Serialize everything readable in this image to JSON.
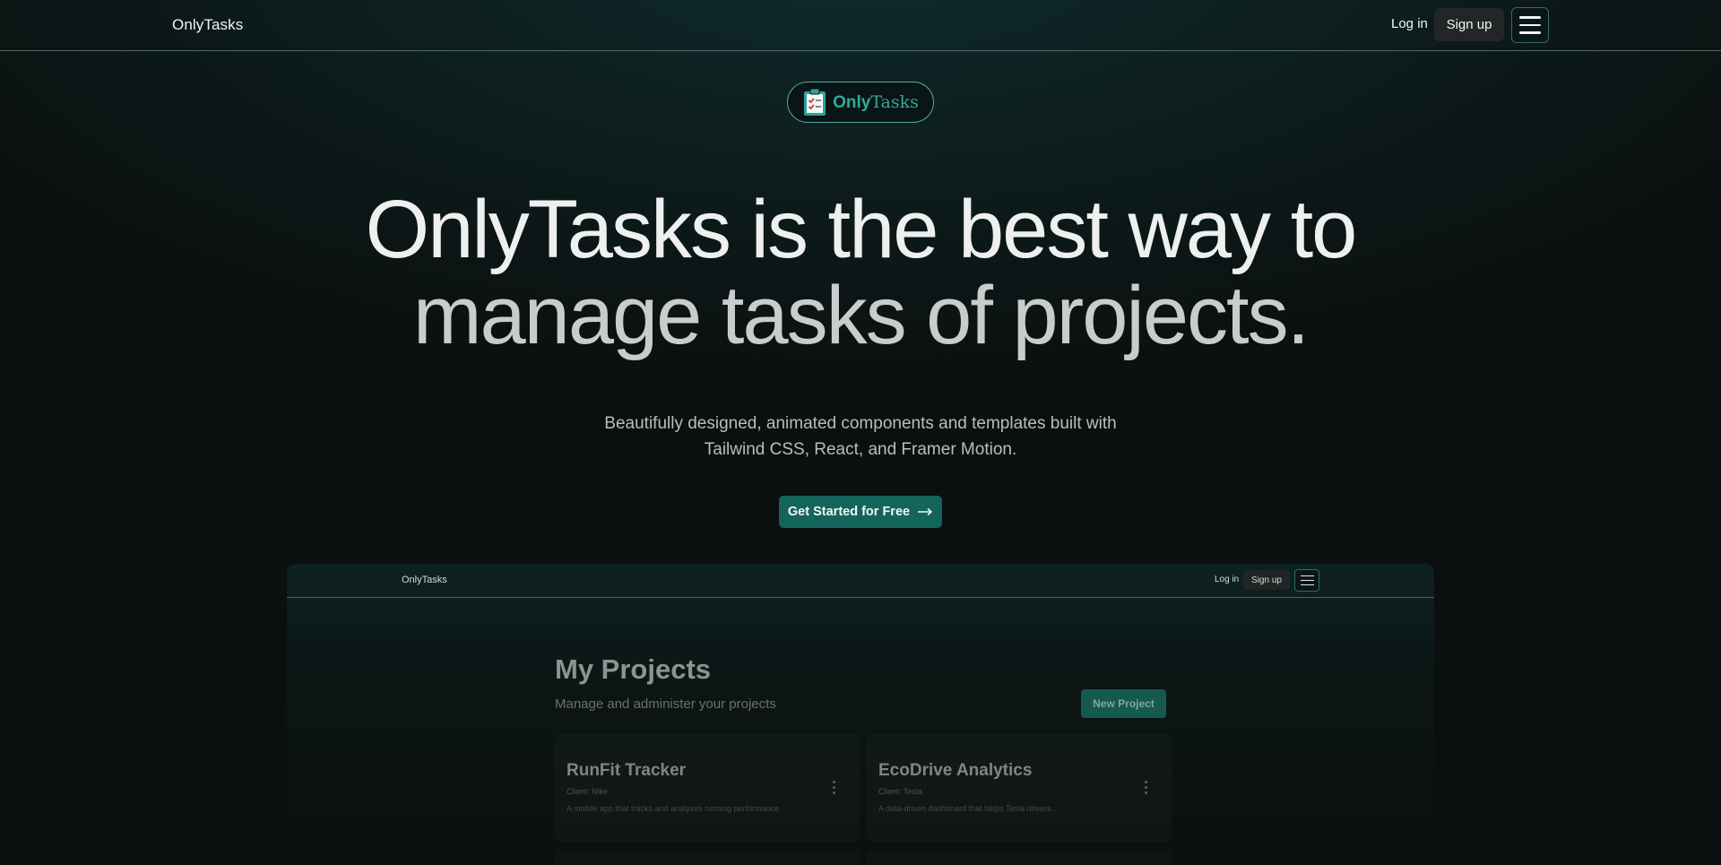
{
  "nav": {
    "brand": "OnlyTasks",
    "login_label": "Log in",
    "signup_label": "Sign up",
    "menu_icon": "hamburger-menu-icon"
  },
  "logo": {
    "icon": "clipboard-check-icon",
    "text_part1": "Only",
    "text_part2": "Tasks",
    "accent_color": "#35a99d"
  },
  "hero": {
    "title_line1": "OnlyTasks is the best way to",
    "title_line2": "manage tasks of projects.",
    "subtitle_line1": "Beautifully designed, animated components and templates built with",
    "subtitle_line2": "Tailwind CSS, React, and Framer Motion.",
    "cta_label": "Get Started for Free",
    "cta_icon": "arrow-right-icon",
    "cta_color": "#136559"
  },
  "preview": {
    "nav": {
      "brand": "OnlyTasks",
      "login_label": "Log in",
      "signup_label": "Sign up"
    },
    "heading": "My Projects",
    "subheading": "Manage and administer your projects",
    "new_project_label": "New Project",
    "projects": [
      {
        "title": "RunFit Tracker",
        "client": "Client: Nike",
        "description": "A mobile app that tracks and analyzes running performance"
      },
      {
        "title": "EcoDrive Analytics",
        "client": "Client: Tesla",
        "description": "A data-driven dashboard that helps Tesla drivers..."
      }
    ]
  }
}
